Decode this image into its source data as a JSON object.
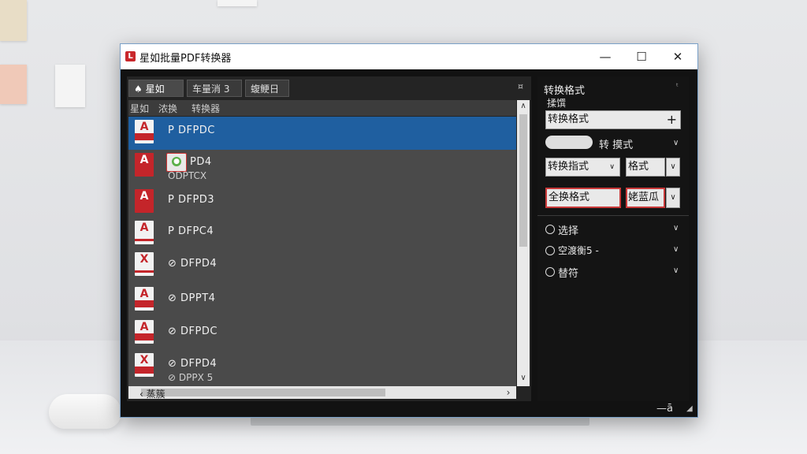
{
  "window": {
    "app_icon": "L",
    "title": "星如批量PDF转换器",
    "minimize": "—",
    "maximize": "☐",
    "close": "✕"
  },
  "left_panel": {
    "tabs": [
      {
        "label": "♠ 星如"
      },
      {
        "label": "车量消 3"
      },
      {
        "label": "蝮鲠日"
      }
    ],
    "pin": "¤",
    "columns": [
      "星如",
      "浓换",
      "转换器"
    ],
    "files": [
      {
        "name": "P DFPDC",
        "sub": "",
        "icon": "A"
      },
      {
        "name": "PD4",
        "sub": "ODPTCX",
        "icon": "A"
      },
      {
        "name": "P DFPD3",
        "sub": "",
        "icon": "A"
      },
      {
        "name": "P DFPC4",
        "sub": "",
        "icon": "A"
      },
      {
        "name": "⊘ DFPD4",
        "sub": "",
        "icon": "X"
      },
      {
        "name": "⊘ DPPT4",
        "sub": "",
        "icon": "A"
      },
      {
        "name": "⊘ DFPDC",
        "sub": "",
        "icon": "A"
      },
      {
        "name": "⊘ DFPD4",
        "sub": "⊘ DPPX 5",
        "icon": "X"
      }
    ],
    "hscroll_label": "‹ 蒸簇",
    "scroll_up": "∧",
    "scroll_down": "∨",
    "scroll_right": "›"
  },
  "right_panel": {
    "title": "转换格式",
    "pin": "ᵗ",
    "sub": "揉馔",
    "format_input": "转换格式",
    "add": "+",
    "toggle_label": "转 摸式",
    "select_format": "转换指式",
    "select_format2": "格式",
    "btn_convert": "全换格式",
    "btn_output": "姥蓝瓜",
    "options": [
      {
        "label": "选择"
      },
      {
        "label": "空渡衡5 -"
      },
      {
        "label": "替符"
      }
    ]
  },
  "statusbar": {
    "label": "—ā",
    "grip": "◢"
  },
  "colors": {
    "accent": "#1f5fa0",
    "pdf_red": "#c4252a",
    "panel_dark": "#141414"
  }
}
